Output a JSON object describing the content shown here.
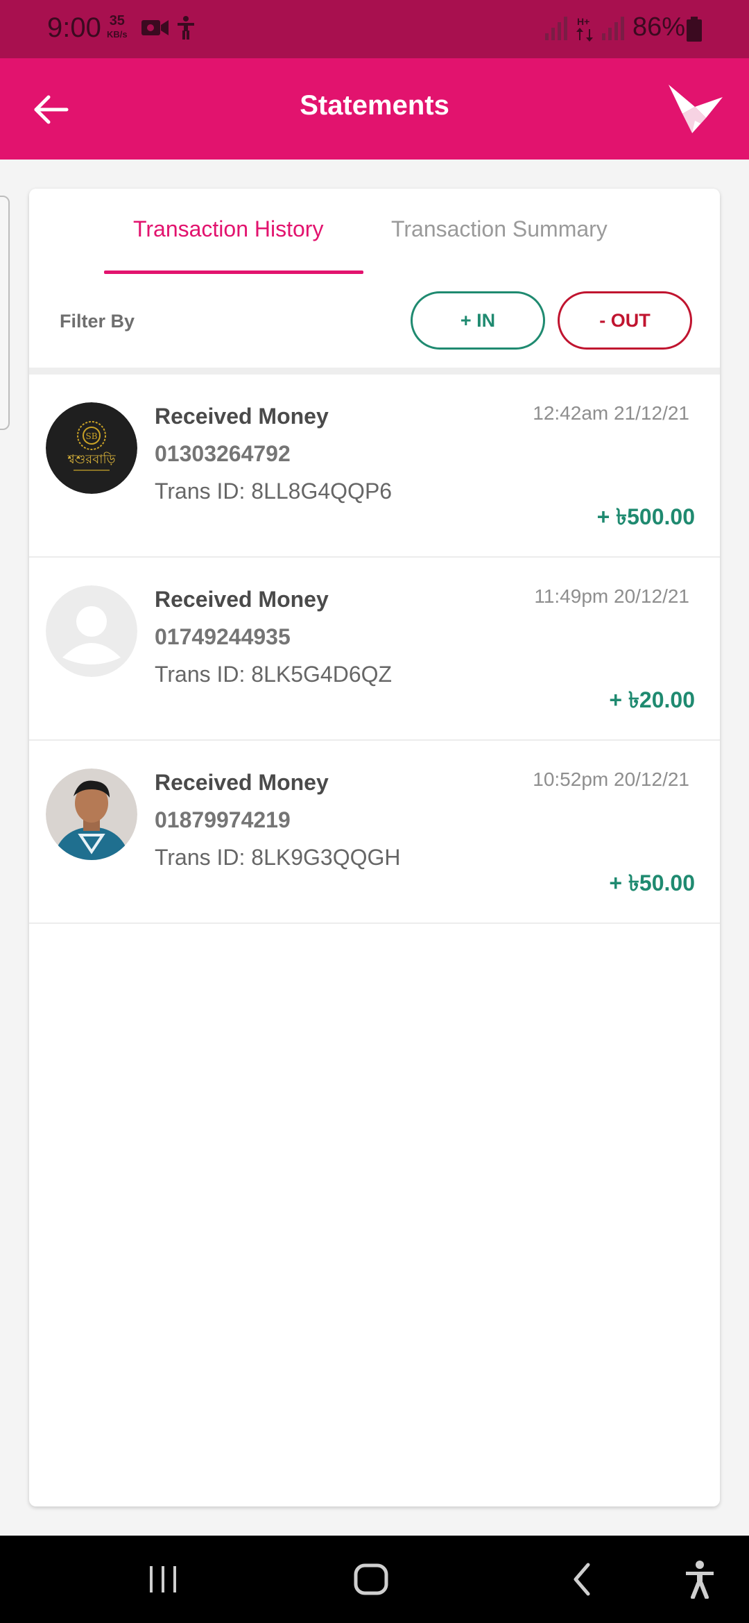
{
  "status_bar": {
    "time": "9:00",
    "speed_value": "35",
    "speed_unit": "KB/s",
    "battery": "86%"
  },
  "app_bar": {
    "title": "Statements",
    "back_icon": "arrow-left-icon",
    "logo_icon": "bkash-bird-logo"
  },
  "tabs": [
    {
      "label": "Transaction History",
      "active": true
    },
    {
      "label": "Transaction Summary",
      "active": false
    }
  ],
  "filter": {
    "label": "Filter By",
    "in_label": "+  IN",
    "out_label": "-  OUT"
  },
  "transactions": [
    {
      "title": "Received Money",
      "phone": "01303264792",
      "trans_id": "Trans ID: 8LL8G4QQP6",
      "time": "12:42am 21/12/21",
      "amount": "+ ৳500.00",
      "avatar": "shop-logo-avatar"
    },
    {
      "title": "Received Money",
      "phone": "01749244935",
      "trans_id": "Trans ID: 8LK5G4D6QZ",
      "time": "11:49pm 20/12/21",
      "amount": "+ ৳20.00",
      "avatar": "default-user-avatar"
    },
    {
      "title": "Received Money",
      "phone": "01879974219",
      "trans_id": "Trans ID: 8LK9G3QQGH",
      "time": "10:52pm 20/12/21",
      "amount": "+ ৳50.00",
      "avatar": "user-photo-avatar"
    }
  ],
  "colors": {
    "brand": "#e2136e",
    "status_bar": "#a8104f",
    "in_green": "#1f8a70",
    "out_red": "#c0142f"
  }
}
